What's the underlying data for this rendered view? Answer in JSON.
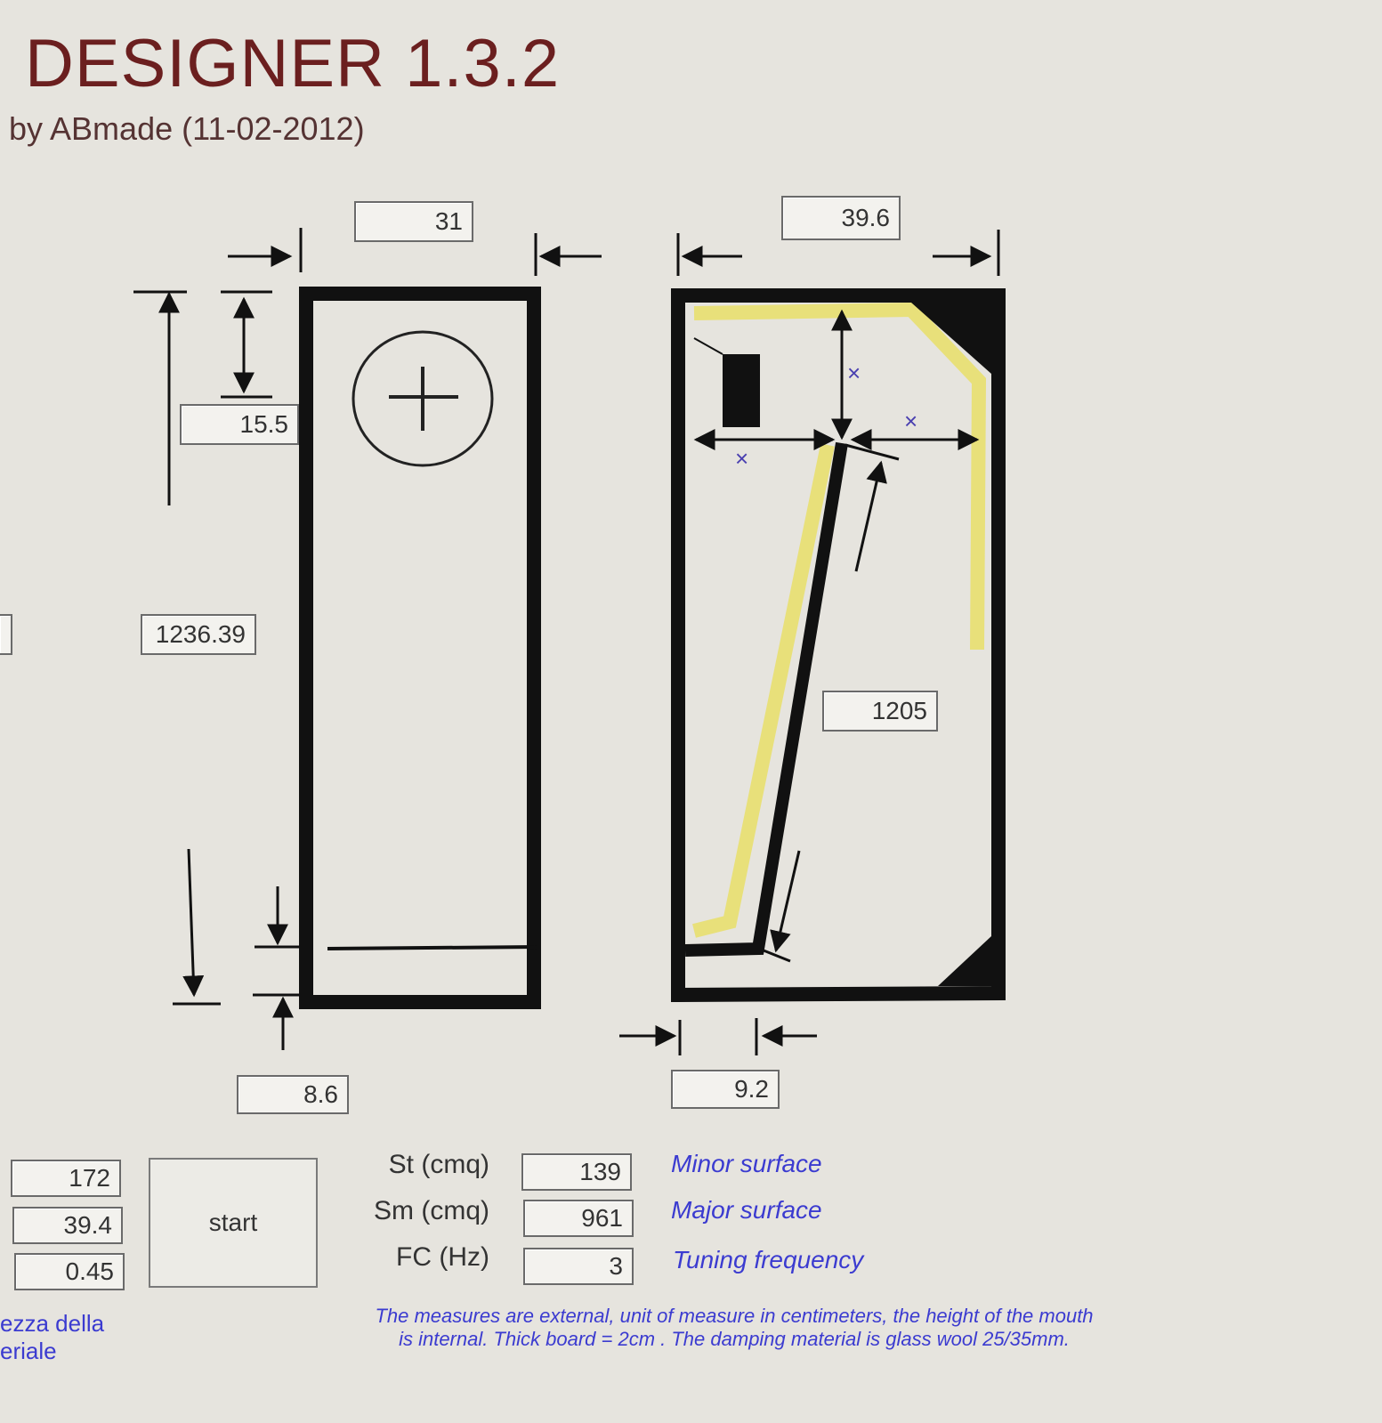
{
  "app": {
    "title": "DESIGNER 1.3.2",
    "subtitle": "by ABmade (11-02-2012)"
  },
  "front_view": {
    "width_value": "31",
    "top_offset_value": "15.5",
    "height_value": "1236.39",
    "bottom_offset_value": "8.6"
  },
  "side_view": {
    "depth_value": "39.6",
    "line_length_value": "1205",
    "mouth_value": "9.2",
    "x_markers": [
      "×",
      "×",
      "×"
    ]
  },
  "inputs": {
    "values": [
      "172",
      "39.4",
      "0.45"
    ],
    "caption_lines": [
      "ezza della",
      "eriale"
    ]
  },
  "start_button": {
    "label": "start"
  },
  "results": [
    {
      "label": "St (cmq)",
      "value": "139",
      "description": "Minor surface"
    },
    {
      "label": "Sm (cmq)",
      "value": "961",
      "description": "Major surface"
    },
    {
      "label": "FC (Hz)",
      "value": "3",
      "description": "Tuning frequency"
    }
  ],
  "note": "The measures are external, unit of measure in centimeters, the height of the mouth is internal. Thick board = 2cm . The damping material is glass wool 25/35mm.",
  "colors": {
    "title": "#6b1f1f",
    "description": "#3b3bd0",
    "damping": "#e8e07a",
    "board": "#111111",
    "background": "#e6e4de"
  }
}
